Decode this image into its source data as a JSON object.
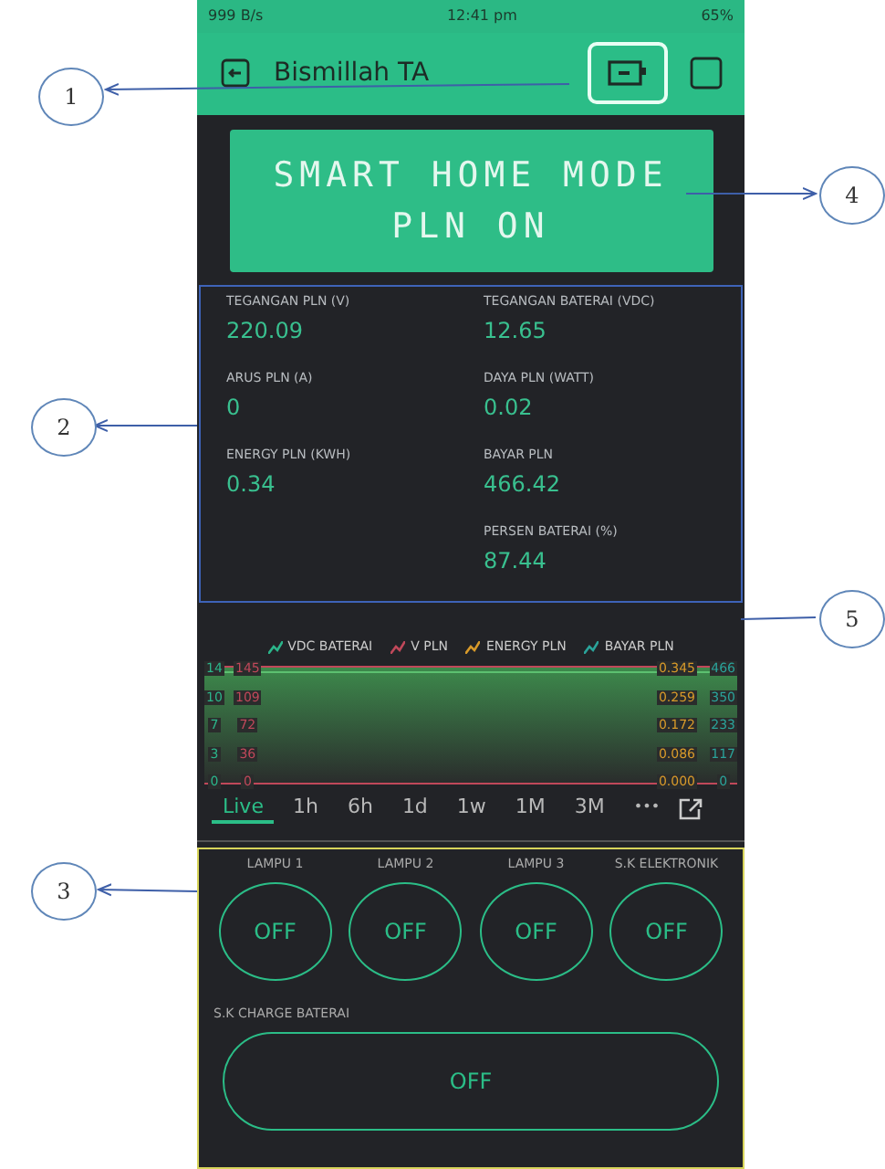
{
  "status_bar": {
    "network": "999 B/s",
    "time": "12:41 pm",
    "battery": "65%"
  },
  "header": {
    "title": "Bismillah TA"
  },
  "lcd": {
    "lines": [
      "SMART HOME MODE",
      "PLN ON"
    ]
  },
  "values_left": [
    {
      "label": "TEGANGAN PLN (V)",
      "value": "220.09"
    },
    {
      "label": "ARUS PLN (A)",
      "value": "0"
    },
    {
      "label": "ENERGY PLN (KWH)",
      "value": "0.34"
    }
  ],
  "values_right": [
    {
      "label": "TEGANGAN BATERAI (VDC)",
      "value": "12.65"
    },
    {
      "label": "DAYA PLN (WATT)",
      "value": "0.02"
    },
    {
      "label": "BAYAR PLN",
      "value": "466.42"
    },
    {
      "label": "PERSEN BATERAI (%)",
      "value": "87.44"
    }
  ],
  "chart": {
    "legend": [
      {
        "name": "VDC BATERAI",
        "color": "#2bb58a"
      },
      {
        "name": "V PLN",
        "color": "#c0485a"
      },
      {
        "name": "ENERGY PLN",
        "color": "#d89a2a"
      },
      {
        "name": "BAYAR PLN",
        "color": "#2aa39a"
      }
    ],
    "left_axes": [
      {
        "color": "#2bb58a",
        "ticks": [
          "14",
          "10",
          "7",
          "3",
          "0"
        ]
      },
      {
        "color": "#c0485a",
        "ticks": [
          "145",
          "109",
          "72",
          "36",
          "0"
        ]
      }
    ],
    "right_axes": [
      {
        "color": "#d89a2a",
        "ticks": [
          "0.345",
          "0.259",
          "0.172",
          "0.086",
          "0.000"
        ]
      },
      {
        "color": "#2aa39a",
        "ticks": [
          "466",
          "350",
          "233",
          "117",
          "0"
        ]
      }
    ],
    "ranges": [
      {
        "label": "Live",
        "selected": true
      },
      {
        "label": "1h",
        "selected": false
      },
      {
        "label": "6h",
        "selected": false
      },
      {
        "label": "1d",
        "selected": false
      },
      {
        "label": "1w",
        "selected": false
      },
      {
        "label": "1M",
        "selected": false
      },
      {
        "label": "3M",
        "selected": false
      }
    ],
    "more": "•••"
  },
  "switches": [
    {
      "label": "LAMPU 1",
      "state": "OFF",
      "on": false
    },
    {
      "label": "LAMPU 2",
      "state": "OFF",
      "on": false
    },
    {
      "label": "LAMPU 3",
      "state": "OFF",
      "on": false
    },
    {
      "label": "S.K ELEKTRONIK",
      "state": "OFF",
      "on": false
    }
  ],
  "wide_switch": {
    "label": "S.K CHARGE BATERAI",
    "state": "OFF",
    "on": false
  },
  "callouts": [
    {
      "number": "1"
    },
    {
      "number": "2"
    },
    {
      "number": "3"
    },
    {
      "number": "4"
    },
    {
      "number": "5"
    }
  ]
}
